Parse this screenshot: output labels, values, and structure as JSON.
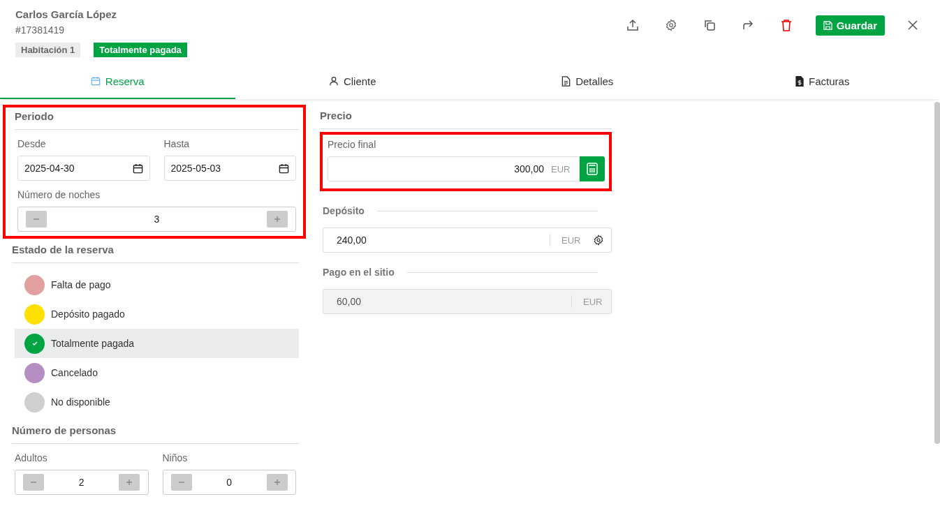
{
  "header": {
    "name": "Carlos García López",
    "booking_id": "#17381419",
    "tags": [
      {
        "label": "Habitación 1",
        "kind": "room"
      },
      {
        "label": "Totalmente pagada",
        "kind": "status"
      }
    ],
    "save_label": "Guardar"
  },
  "tabs": [
    {
      "label": "Reserva",
      "selected": true
    },
    {
      "label": "Cliente",
      "selected": false
    },
    {
      "label": "Detalles",
      "selected": false
    },
    {
      "label": "Facturas",
      "selected": false
    }
  ],
  "period": {
    "title": "Periodo",
    "highlighted": true,
    "from": {
      "label": "Desde",
      "value": "2025-04-30"
    },
    "to": {
      "label": "Hasta",
      "value": "2025-05-03"
    },
    "nights": {
      "label": "Número de noches",
      "value": "3"
    }
  },
  "status": {
    "title": "Estado de la reserva",
    "options": [
      {
        "label": "Falta de pago",
        "color": "#e3a0a0",
        "selected": false
      },
      {
        "label": "Depósito pagado",
        "color": "#ffe000",
        "selected": false
      },
      {
        "label": "Totalmente pagada",
        "color": "#00a443",
        "selected": true
      },
      {
        "label": "Cancelado",
        "color": "#b58fc3",
        "selected": false
      },
      {
        "label": "No disponible",
        "color": "#cfcfcf",
        "selected": false
      }
    ]
  },
  "persons": {
    "title": "Número de personas",
    "adults": {
      "label": "Adultos",
      "value": "2"
    },
    "children": {
      "label": "Niños",
      "value": "0"
    }
  },
  "price": {
    "title": "Precio",
    "final": {
      "label": "Precio final",
      "value": "300,00",
      "currency": "EUR",
      "highlighted": true
    },
    "deposit": {
      "label": "Depósito",
      "value": "240,00",
      "currency": "EUR"
    },
    "onsite": {
      "label": "Pago en el sitio",
      "value": "60,00",
      "currency": "EUR",
      "disabled": true
    }
  }
}
